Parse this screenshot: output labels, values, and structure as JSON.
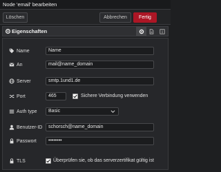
{
  "window": {
    "title": "Node 'email' bearbeiten"
  },
  "toolbar": {
    "delete_label": "Löschen",
    "cancel_label": "Abbrechen",
    "done_label": "Fertig"
  },
  "section": {
    "title": "Eigenschaften"
  },
  "fields": {
    "name": {
      "label": "Name",
      "value": "Name"
    },
    "to": {
      "label": "An",
      "value": "mail@name_domain"
    },
    "server": {
      "label": "Server",
      "value": "smtp.1und1.de"
    },
    "port": {
      "label": "Port",
      "value": "465"
    },
    "secure": {
      "label": "Sichere Verbindung verwenden",
      "checked": true
    },
    "auth_type": {
      "label": "Auth type",
      "value": "Basic"
    },
    "user": {
      "label": "Benutzer-ID",
      "value": "schorsch@name_domain"
    },
    "password": {
      "label": "Passwort",
      "value": "••••••••"
    },
    "tls": {
      "label": "TLS",
      "checkbox_label": "Überprüfen sie, ob das serverzertifikat gültig ist",
      "checked": true
    }
  },
  "colors": {
    "accent": "#ad1625",
    "background": "#1e1f21",
    "panel": "#26272a"
  },
  "icons": {
    "section": "gear-icon",
    "tabs": [
      "gear-icon",
      "document-icon",
      "info-icon"
    ],
    "name": "tag-icon",
    "to": "envelope-icon",
    "server": "globe-icon",
    "port": "random-icon",
    "auth_type": "list-icon",
    "user": "user-icon",
    "password": "lock-icon",
    "tls": "lock-icon"
  }
}
